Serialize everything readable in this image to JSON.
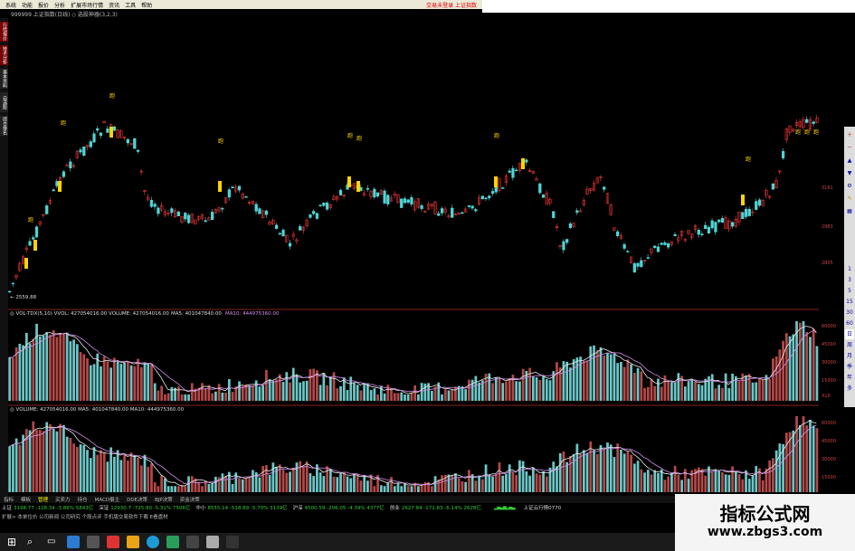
{
  "menu": {
    "items": [
      "系统",
      "功能",
      "报价",
      "分析",
      "扩展市场行情",
      "资讯",
      "工具",
      "帮助"
    ],
    "right_text": "交易未登录  上证指数"
  },
  "title_bar": "999999 上证指数(日线)  ◇ 选股神器(3,2,3)",
  "sidebar_tabs": [
    "行情报价",
    "技术分析",
    "基本资料",
    "自选股",
    "综合排名"
  ],
  "main_chart": {
    "marker_label": "跑",
    "low_label": "← 2559.88",
    "axis_labels": [
      "3161",
      "2983",
      "2805"
    ]
  },
  "vol_panel": {
    "label_prefix": "◎ VOL-TDX(5,10)  VVOL: 427054016.00  VOLUME: 427054016.00",
    "ma5": "MA5: 401047840.00",
    "ma10": "MA10: 444975360.00",
    "axis_labels": [
      "60000",
      "45000",
      "30000",
      "15000",
      "X10"
    ],
    "unit": "X10"
  },
  "vol2_panel": {
    "label": "◎ VOLUME: 427054016.00  MA5: 401047840.00  MA10: 444975360.00",
    "axis_labels": [
      "60000",
      "45000",
      "30000",
      "15000"
    ]
  },
  "bottom_tabs": [
    "指标",
    "模板",
    "管理",
    "买卖力",
    "持仓",
    "MACD摄主",
    "DDE决策",
    "BJP决策",
    "资金决策"
  ],
  "ticker": [
    {
      "name": "上证",
      "text": "3198.77 -128.34 -3.86% 5843亿",
      "color": "#3c3"
    },
    {
      "name": "深证",
      "text": "12930.7 -725.80 -5.31% 7506亿",
      "color": "#3c3"
    },
    {
      "name": "中小",
      "text": "8555.14 -518.89 -5.70% 3139亿",
      "color": "#3c3"
    },
    {
      "name": "沪深",
      "text": "4500.59 -206.05 -4.39% 4377亿",
      "color": "#3c3"
    },
    {
      "name": "创业",
      "text": "2627.84 -171.83 -6.14% 2628亿",
      "color": "#3c3"
    }
  ],
  "ticker_right": "上证云行情0770",
  "ticker2": "扩展> 本单位价  公司新闻  公司研究  个股点评  手机版交易软件下载 E看盘材",
  "right_tools": [
    "1",
    "3",
    "5",
    "15",
    "30",
    "60",
    "日",
    "周",
    "月",
    "季",
    "年",
    "多"
  ],
  "watermark": {
    "title": "指标公式网",
    "url": "www.zbgs3.com"
  },
  "colors": {
    "up": "#ff3b3b",
    "down": "#4fd6d6",
    "marker": "#ffd400",
    "ma5": "#e8e8e8",
    "ma10": "#d28ce6",
    "vol_up": "#b54848",
    "vol_down": "#6cc7c7"
  }
}
